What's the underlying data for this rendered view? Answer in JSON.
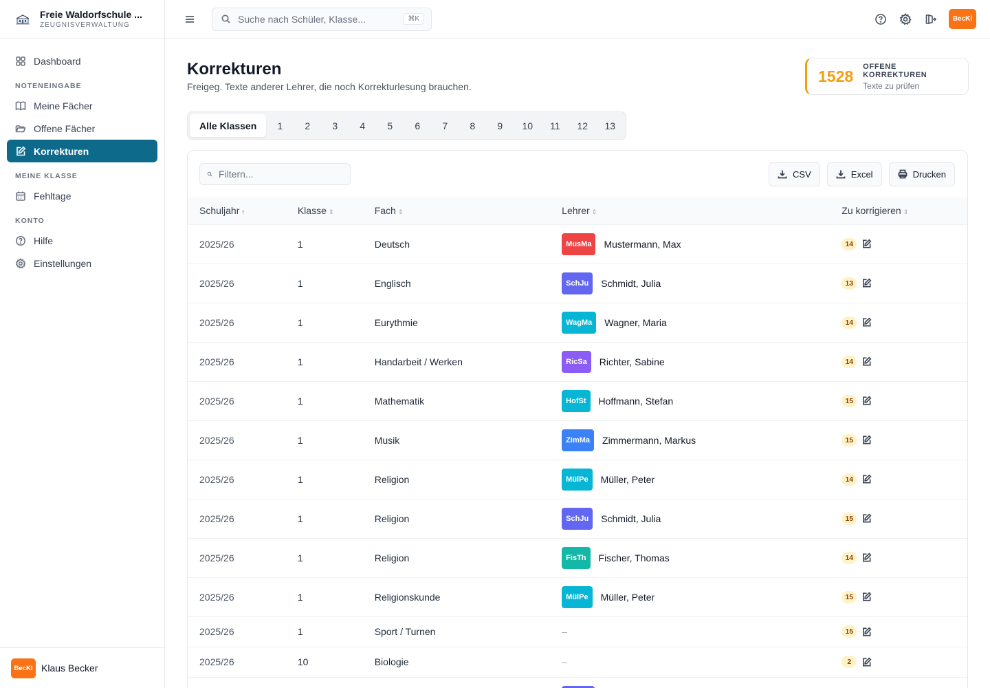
{
  "brand": {
    "title": "Freie Waldorfschule ...",
    "subtitle": "ZEUGNISVERWALTUNG"
  },
  "sidebar": {
    "dashboard": "Dashboard",
    "section_noteneingabe": "NOTENEINGABE",
    "meine_faecher": "Meine Fächer",
    "offene_faecher": "Offene Fächer",
    "korrekturen": "Korrekturen",
    "section_meine_klasse": "MEINE KLASSE",
    "fehltage": "Fehltage",
    "section_konto": "KONTO",
    "hilfe": "Hilfe",
    "einstellungen": "Einstellungen"
  },
  "user": {
    "initials": "BecKl",
    "name": "Klaus Becker"
  },
  "search": {
    "placeholder": "Suche nach Schüler, Klasse...",
    "shortcut": "⌘K"
  },
  "page": {
    "title": "Korrekturen",
    "description": "Freigeg. Texte anderer Lehrer, die noch Korrekturlesung brauchen."
  },
  "stat": {
    "value": "1528",
    "label": "OFFENE KORREKTUREN",
    "sub": "Texte zu prüfen"
  },
  "tabs": [
    "Alle Klassen",
    "1",
    "2",
    "3",
    "4",
    "5",
    "6",
    "7",
    "8",
    "9",
    "10",
    "11",
    "12",
    "13"
  ],
  "toolbar": {
    "filter_placeholder": "Filtern...",
    "csv": "CSV",
    "excel": "Excel",
    "print": "Drucken"
  },
  "table": {
    "headers": [
      "Schuljahr",
      "Klasse",
      "Fach",
      "Lehrer",
      "Zu korrigieren"
    ],
    "rows": [
      {
        "year": "2025/26",
        "klasse": "1",
        "fach": "Deutsch",
        "badge": "MusMa",
        "badge_color": "#ef4444",
        "lehrer": "Mustermann, Max",
        "count": "14"
      },
      {
        "year": "2025/26",
        "klasse": "1",
        "fach": "Englisch",
        "badge": "SchJu",
        "badge_color": "#6366f1",
        "lehrer": "Schmidt, Julia",
        "count": "13"
      },
      {
        "year": "2025/26",
        "klasse": "1",
        "fach": "Eurythmie",
        "badge": "WagMa",
        "badge_color": "#06b6d4",
        "lehrer": "Wagner, Maria",
        "count": "14"
      },
      {
        "year": "2025/26",
        "klasse": "1",
        "fach": "Handarbeit / Werken",
        "badge": "RicSa",
        "badge_color": "#8b5cf6",
        "lehrer": "Richter, Sabine",
        "count": "14"
      },
      {
        "year": "2025/26",
        "klasse": "1",
        "fach": "Mathematik",
        "badge": "HofSt",
        "badge_color": "#06b6d4",
        "lehrer": "Hoffmann, Stefan",
        "count": "15"
      },
      {
        "year": "2025/26",
        "klasse": "1",
        "fach": "Musik",
        "badge": "ZimMa",
        "badge_color": "#3b82f6",
        "lehrer": "Zimmermann, Markus",
        "count": "15"
      },
      {
        "year": "2025/26",
        "klasse": "1",
        "fach": "Religion",
        "badge": "MülPe",
        "badge_color": "#06b6d4",
        "lehrer": "Müller, Peter",
        "count": "14"
      },
      {
        "year": "2025/26",
        "klasse": "1",
        "fach": "Religion",
        "badge": "SchJu",
        "badge_color": "#6366f1",
        "lehrer": "Schmidt, Julia",
        "count": "15"
      },
      {
        "year": "2025/26",
        "klasse": "1",
        "fach": "Religion",
        "badge": "FisTh",
        "badge_color": "#14b8a6",
        "lehrer": "Fischer, Thomas",
        "count": "14"
      },
      {
        "year": "2025/26",
        "klasse": "1",
        "fach": "Religionskunde",
        "badge": "MülPe",
        "badge_color": "#06b6d4",
        "lehrer": "Müller, Peter",
        "count": "15"
      },
      {
        "year": "2025/26",
        "klasse": "1",
        "fach": "Sport / Turnen",
        "badge": "",
        "badge_color": "",
        "lehrer": "–",
        "count": "15"
      },
      {
        "year": "2025/26",
        "klasse": "10",
        "fach": "Biologie",
        "badge": "",
        "badge_color": "",
        "lehrer": "–",
        "count": "2"
      },
      {
        "year": "",
        "klasse": "",
        "fach": "",
        "badge": "",
        "badge_color": "#6366f1",
        "lehrer": "",
        "count": ""
      }
    ]
  },
  "colors": {
    "accent": "#0e6a8a",
    "orange": "#f97316",
    "amber": "#f59e0b"
  }
}
